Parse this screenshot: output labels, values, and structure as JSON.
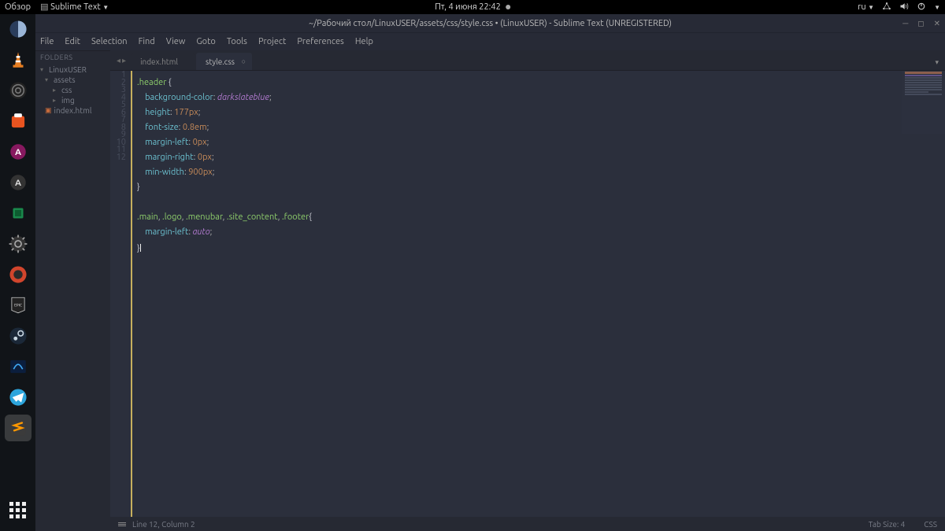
{
  "panel": {
    "activities": "Обзор",
    "app_label": "Sublime Text",
    "datetime": "Пт, 4 июня  22:42",
    "lang": "ru"
  },
  "dock_items": [
    "web",
    "vlc",
    "obs",
    "software",
    "apps-store",
    "update",
    "chip",
    "settings",
    "tf2",
    "epic",
    "steam",
    "battlenet",
    "telegram",
    "sublime"
  ],
  "window": {
    "title": "~/Рабочий стол/LinuxUSER/assets/css/style.css • (LinuxUSER) - Sublime Text (UNREGISTERED)"
  },
  "menu": [
    "File",
    "Edit",
    "Selection",
    "Find",
    "View",
    "Goto",
    "Tools",
    "Project",
    "Preferences",
    "Help"
  ],
  "sidebar": {
    "heading": "FOLDERS",
    "root": "LinuxUSER",
    "assets": "assets",
    "css": "css",
    "img": "img",
    "index": "index.html"
  },
  "tabs": {
    "t1": "index.html",
    "t2": "style.css"
  },
  "code": {
    "l1_sel": ".header",
    "l1_b": " {",
    "l2_prop": "background-color",
    "l2_colon": ": ",
    "l2_val": "darkslateblue",
    "l2_end": ";",
    "l3_prop": "height",
    "l3_colon": ": ",
    "l3_val": "177px",
    "l3_end": ";",
    "l4_prop": "font-size",
    "l4_colon": ": ",
    "l4_val": "0.8em",
    "l4_end": ";",
    "l5_prop": "margin-left",
    "l5_colon": ": ",
    "l5_val": "0px",
    "l5_end": ";",
    "l6_prop": "margin-right",
    "l6_colon": ": ",
    "l6_val": "0px",
    "l6_end": ";",
    "l7_prop": "min-width",
    "l7_colon": ": ",
    "l7_val": "900px",
    "l7_end": ";",
    "l8": "}",
    "l10_a": ".main",
    "l10_c1": ", ",
    "l10_b": ".logo",
    "l10_c2": ", ",
    "l10_c": ".menubar",
    "l10_c3": ", ",
    "l10_d": ".site_content",
    "l10_c4": ", ",
    "l10_e": ".footer",
    "l10_b2": "{",
    "l11_prop": "margin-left",
    "l11_colon": ": ",
    "l11_val": "auto",
    "l11_end": ";",
    "l12": "}"
  },
  "line_numbers": [
    "1",
    "2",
    "3",
    "4",
    "5",
    "6",
    "7",
    "8",
    "9",
    "10",
    "11",
    "12"
  ],
  "status": {
    "pos": "Line 12, Column 2",
    "tabsize": "Tab Size: 4",
    "syntax": "CSS"
  }
}
